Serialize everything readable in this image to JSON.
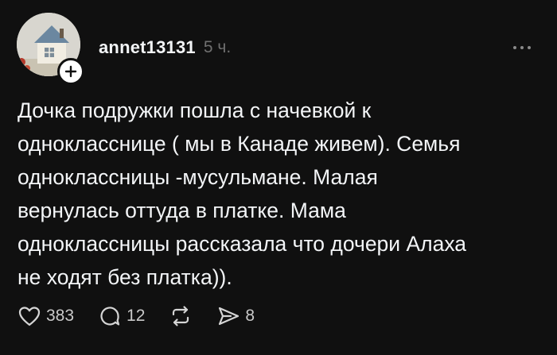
{
  "post": {
    "username": "annet13131",
    "timestamp": "5 ч.",
    "text": "Дочка подружки пошла с начевкой к\nоднокласснице ( мы в Канаде живем). Семья\nодноклассницы -мусульмане. Малая\nвернулась оттуда в платке. Мама\nодноклассницы рассказала что дочери Алаха\nне ходят без платка)).",
    "actions": {
      "likes": "383",
      "comments": "12",
      "shares": "8"
    },
    "icons": {
      "like": "heart-icon",
      "comment": "comment-bubble-icon",
      "repost": "repost-icon",
      "share": "send-icon",
      "more": "more-dots-icon",
      "follow": "plus-icon"
    }
  },
  "colors": {
    "background": "#101010",
    "text": "#f3f5f7",
    "muted": "#6f6f6f"
  }
}
